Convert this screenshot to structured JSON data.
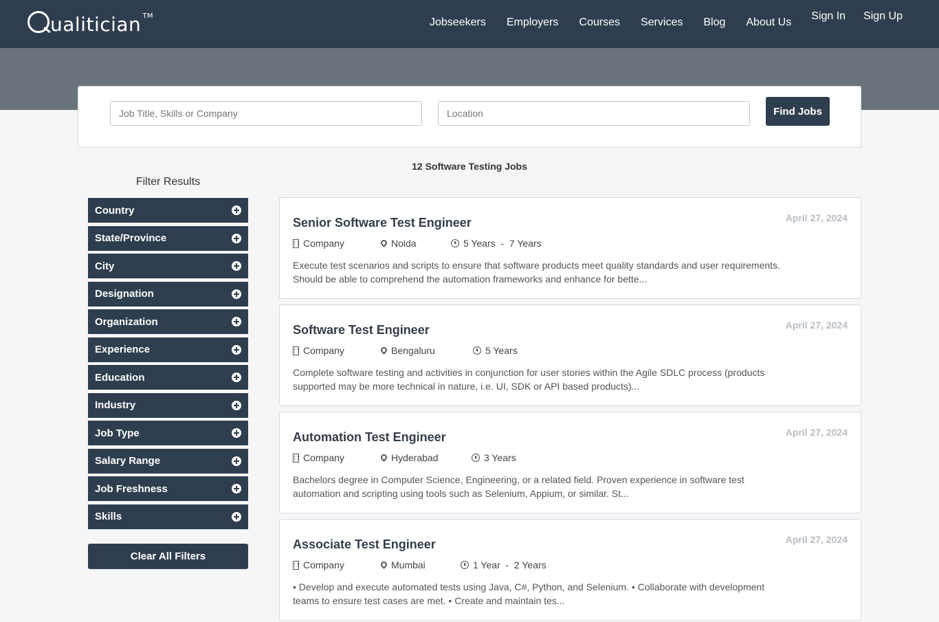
{
  "brand": {
    "name_rest": "ualitician",
    "tm": "TM"
  },
  "nav": [
    "Jobseekers",
    "Employers",
    "Courses",
    "Services",
    "Blog",
    "About Us"
  ],
  "auth": {
    "sign_in": "Sign In",
    "sign_up": "Sign Up"
  },
  "search": {
    "keyword_placeholder": "Job Title, Skills or Company",
    "location_placeholder": "Location",
    "button": "Find Jobs"
  },
  "results_count": "12 Software Testing Jobs",
  "filters": {
    "title": "Filter Results",
    "items": [
      "Country",
      "State/Province",
      "City",
      "Designation",
      "Organization",
      "Experience",
      "Education",
      "Industry",
      "Job Type",
      "Salary Range",
      "Job Freshness",
      "Skills"
    ],
    "clear": "Clear All Filters"
  },
  "jobs": [
    {
      "title": "Senior Software Test Engineer",
      "date": "April 27, 2024",
      "company": "Company",
      "location": "Noida",
      "experience": "5 Years  -  7 Years",
      "description": "Execute test scenarios and scripts to ensure that software products meet quality standards and user requirements. Should be able to comprehend the automation frameworks and enhance for bette..."
    },
    {
      "title": "Software Test Engineer",
      "date": "April 27, 2024",
      "company": "Company",
      "location": "Bengaluru",
      "experience": "5 Years",
      "description": "Complete software testing and activities in conjunction for user stories within the Agile SDLC process (products supported may be more technical in nature, i.e. UI, SDK or API based products)..."
    },
    {
      "title": "Automation Test Engineer",
      "date": "April 27, 2024",
      "company": "Company",
      "location": "Hyderabad",
      "experience": "3 Years",
      "description": "Bachelors degree in Computer Science, Engineering, or a related field. Proven experience in software test automation and scripting using tools such as Selenium, Appium, or similar. St..."
    },
    {
      "title": "Associate Test Engineer",
      "date": "April 27, 2024",
      "company": "Company",
      "location": "Mumbai",
      "experience": "1 Year  -  2 Years",
      "description": "• Develop and execute automated tests using Java, C#, Python, and Selenium. • Collaborate with development teams to ensure test cases are met. • Create and maintain tes..."
    }
  ]
}
